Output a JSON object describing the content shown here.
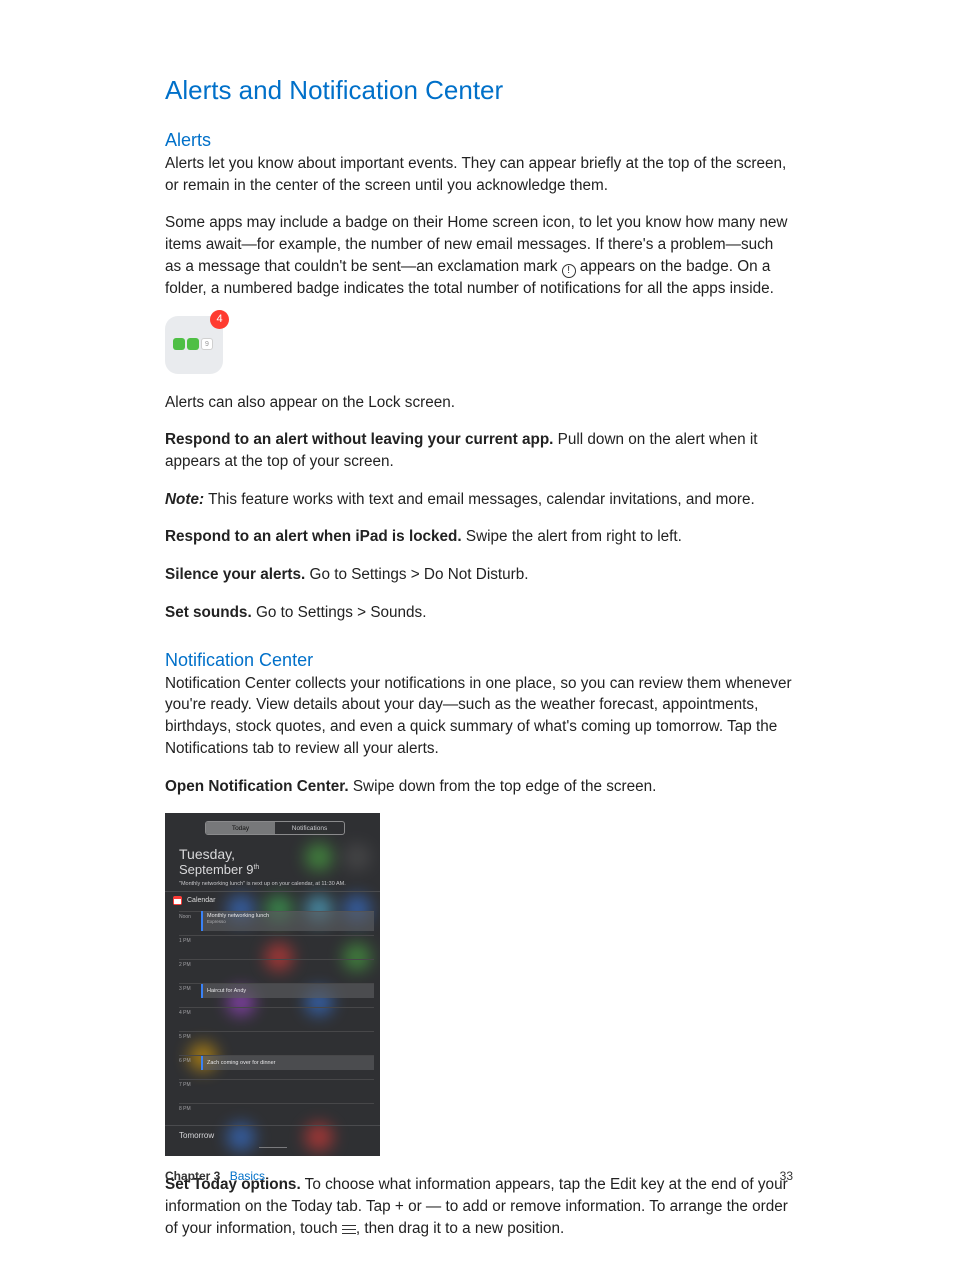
{
  "title": "Alerts and Notification Center",
  "sections": {
    "alerts": {
      "heading": "Alerts",
      "p1": "Alerts let you know about important events. They can appear briefly at the top of the screen, or remain in the center of the screen until you acknowledge them.",
      "p2a": "Some apps may include a badge on their Home screen icon, to let you know how many new items await—for example, the number of new email messages. If there's a problem—such as a message that couldn't be sent—an exclamation mark ",
      "p2b": " appears on the badge. On a folder, a numbered badge indicates the total number of notifications for all the apps inside.",
      "badge_value": "4",
      "p3": "Alerts can also appear on the Lock screen.",
      "respond_app_bold": "Respond to an alert without leaving your current app.",
      "respond_app_text": " Pull down on the alert when it appears at the top of your screen.",
      "note_label": "Note:",
      "note_text": "  This feature works with text and email messages, calendar invitations, and more.",
      "respond_locked_bold": "Respond to an alert when iPad is locked.",
      "respond_locked_text": " Swipe the alert from right to left.",
      "silence_bold": "Silence your alerts.",
      "silence_text": " Go to Settings > Do Not Disturb.",
      "sounds_bold": "Set sounds.",
      "sounds_text": " Go to Settings > Sounds."
    },
    "nc": {
      "heading": "Notification Center",
      "p1": "Notification Center collects your notifications in one place, so you can review them whenever you're ready. View details about your day—such as the weather forecast, appointments, birthdays, stock quotes, and even a quick summary of what's coming up tomorrow. Tap the Notifications tab to review all your alerts.",
      "open_bold": "Open Notification Center.",
      "open_text": " Swipe down from the top edge of the screen.",
      "today_bold": "Set Today options.",
      "today_text_a": " To choose what information appears, tap the Edit key at the end of your information on the Today tab. Tap + or — to add or remove information. To arrange the order of your information, touch ",
      "today_text_b": ", then drag it to a new position."
    }
  },
  "nc_figure": {
    "tab_today": "Today",
    "tab_notifications": "Notifications",
    "day": "Tuesday,",
    "date_main": "September 9",
    "date_suffix": "th",
    "summary": "\"Monthly networking lunch\" is next up on your calendar, at 11:30 AM.",
    "calendar_label": "Calendar",
    "times": [
      "Noon",
      "1 PM",
      "2 PM",
      "3 PM",
      "4 PM",
      "5 PM",
      "6 PM",
      "7 PM",
      "8 PM"
    ],
    "event1_title": "Monthly networking lunch",
    "event1_sub": "Expresso",
    "event2_title": "Haircut for Andy",
    "event3_title": "Zach coming over for dinner",
    "tomorrow": "Tomorrow"
  },
  "footer": {
    "chapter_label": "Chapter  3",
    "chapter_name": "Basics",
    "page": "33"
  }
}
